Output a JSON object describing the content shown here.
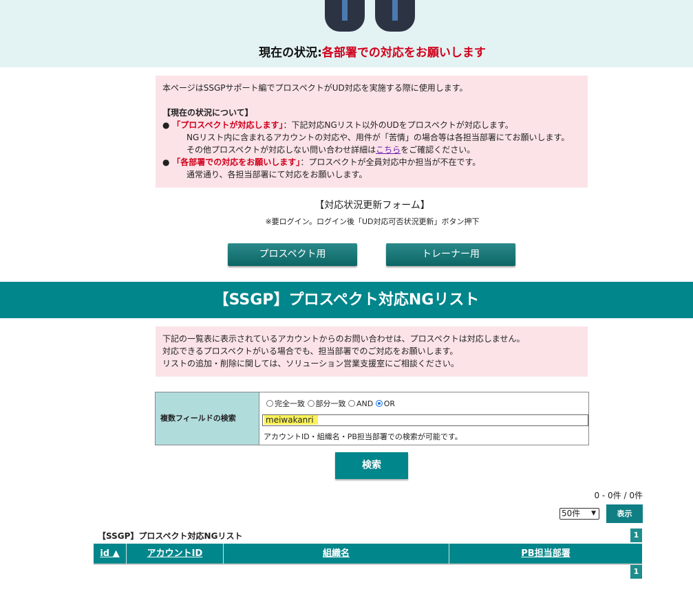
{
  "header": {
    "status_label": "現在の状況:",
    "status_value": "各部署での対応をお願いします"
  },
  "info_box": {
    "intro": "本ページはSSGPサポート編でプロスペクトがUD対応を実施する際に使用します。",
    "section_title": "【現在の状況について】",
    "bullet1_red": "「プロスペクトが対応します」",
    "bullet1_text": "：下記対応NGリスト以外のUDをプロスペクトが対応します。",
    "bullet1_line2": "NGリスト内に含まれるアカウントの対応や、用件が「苦情」の場合等は各担当部署にてお願いします。",
    "bullet1_line3_a": "その他プロスペクトが対応しない問い合わせ詳細は",
    "bullet1_line3_link": "こちら",
    "bullet1_line3_b": "をご確認ください。",
    "bullet2_red": "「各部署での対応をお願いします」",
    "bullet2_text": "：プロスペクトが全員対応中か担当が不在です。",
    "bullet2_line2": "通常通り、各担当部署にて対応をお願いします。"
  },
  "update_form": {
    "title": "【対応状況更新フォーム】",
    "note": "※要ログイン。ログイン後「UD対応可否状況更新」ボタン押下",
    "prospect_button": "プロスペクト用",
    "trainer_button": "トレーナー用"
  },
  "banner": {
    "title": "【SSGP】プロスペクト対応NGリスト"
  },
  "notice_box": {
    "line1": "下記の一覧表に表示されているアカウントからのお問い合わせは、プロスペクトは対応しません。",
    "line2": "対応できるプロスペクトがいる場合でも、担当部署でのご対応をお願いします。",
    "line3": "リストの追加・削除に関しては、ソリューション営業支援室にご相談ください。"
  },
  "search": {
    "label": "複数フィールドの検索",
    "options": [
      "完全一致",
      "部分一致",
      "AND",
      "OR"
    ],
    "selected": "OR",
    "value": "meiwakanri",
    "help": "アカウントID・組織名・PB担当部署での検索が可能です。",
    "button": "検索"
  },
  "results": {
    "count_text": "0 - 0件 / 0件",
    "per_page": "50件",
    "show_button": "表示",
    "list_title": "【SSGP】プロスペクト対応NGリスト",
    "page": "1",
    "columns": [
      "id ▲",
      "アカウントID",
      "組織名",
      "PB担当部署"
    ]
  },
  "colors": {
    "teal": "#00868b",
    "alert_red": "#d0001c",
    "pink_bg": "#fbe3e8"
  }
}
